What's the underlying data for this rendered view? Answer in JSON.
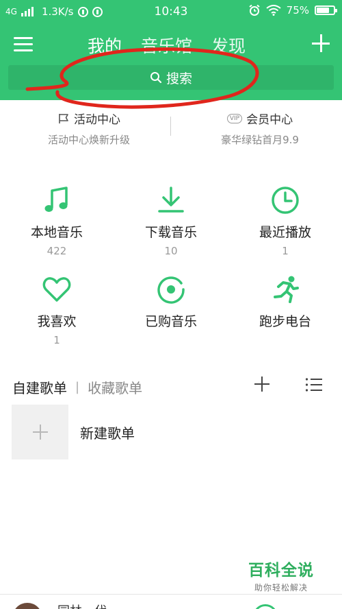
{
  "status_bar": {
    "network": "4G",
    "speed": "1.3K/s",
    "time": "10:43",
    "battery": "75%"
  },
  "header": {
    "tabs": [
      {
        "label": "我的",
        "active": true
      },
      {
        "label": "音乐馆",
        "active": false
      },
      {
        "label": "发现",
        "active": false
      }
    ],
    "menu_icon": "hamburger-menu-icon",
    "add_icon": "plus-icon"
  },
  "search": {
    "label": "搜索",
    "icon": "search-icon"
  },
  "promos": [
    {
      "title": "活动中心",
      "subtitle": "活动中心焕新升级",
      "icon": "flag-icon"
    },
    {
      "title": "会员中心",
      "subtitle": "豪华绿钻首月9.9",
      "icon": "vip-icon",
      "badge": "VIP"
    }
  ],
  "grid": [
    {
      "label": "本地音乐",
      "count": "422",
      "icon": "music-note-icon"
    },
    {
      "label": "下载音乐",
      "count": "10",
      "icon": "download-icon"
    },
    {
      "label": "最近播放",
      "count": "1",
      "icon": "clock-icon"
    },
    {
      "label": "我喜欢",
      "count": "1",
      "icon": "heart-icon"
    },
    {
      "label": "已购音乐",
      "count": "",
      "icon": "purchased-disc-icon"
    },
    {
      "label": "跑步电台",
      "count": "",
      "icon": "running-icon"
    }
  ],
  "playlists": {
    "tabs": [
      {
        "label": "自建歌单",
        "active": true
      },
      {
        "label": "收藏歌单",
        "active": false
      }
    ],
    "new_playlist_label": "新建歌单"
  },
  "watermark": {
    "title": "百科全说",
    "subtitle": "助你轻松解决"
  },
  "mini_player": {
    "title": "园林…代"
  },
  "colors": {
    "brand_green": "#34c474",
    "annotation_red": "#e0261c"
  }
}
